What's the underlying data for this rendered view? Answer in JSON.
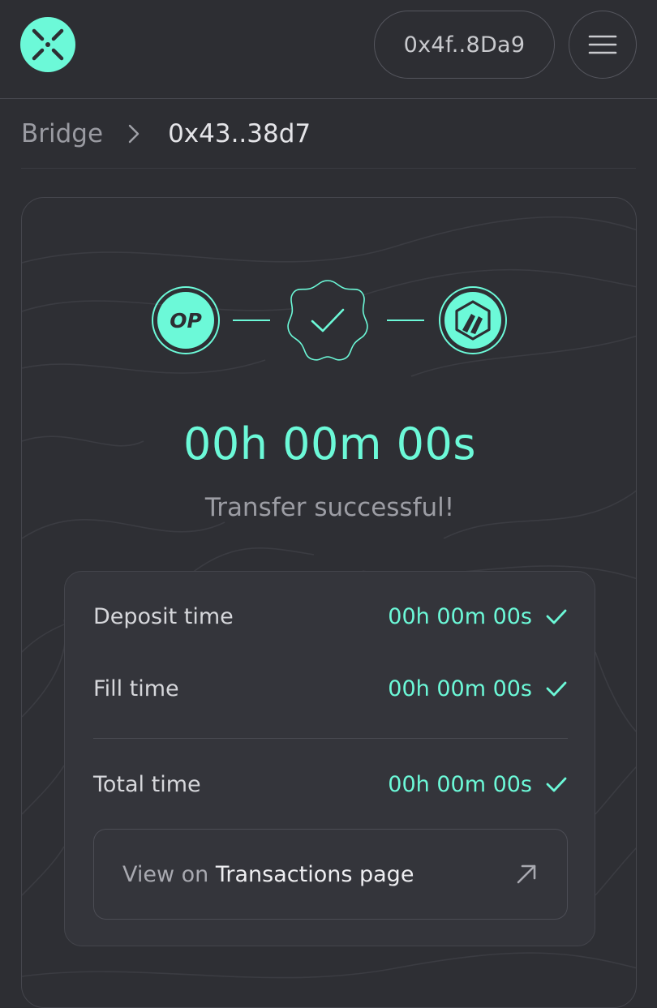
{
  "header": {
    "wallet_address": "0x4f..8Da9"
  },
  "breadcrumb": {
    "root": "Bridge",
    "current": "0x43..38d7"
  },
  "route": {
    "from_chain": "OP",
    "to_chain_icon": "arbitrum-icon"
  },
  "transfer": {
    "elapsed": "00h 00m 00s",
    "status": "Transfer successful!"
  },
  "details": {
    "rows": [
      {
        "label": "Deposit time",
        "value": "00h 00m 00s"
      },
      {
        "label": "Fill time",
        "value": "00h 00m 00s"
      },
      {
        "label": "Total time",
        "value": "00h 00m 00s"
      }
    ],
    "link_prefix": "View on",
    "link_target": "Transactions page"
  },
  "colors": {
    "accent": "#6cf9d8",
    "background": "#2d2e33",
    "panel": "#34353b"
  }
}
